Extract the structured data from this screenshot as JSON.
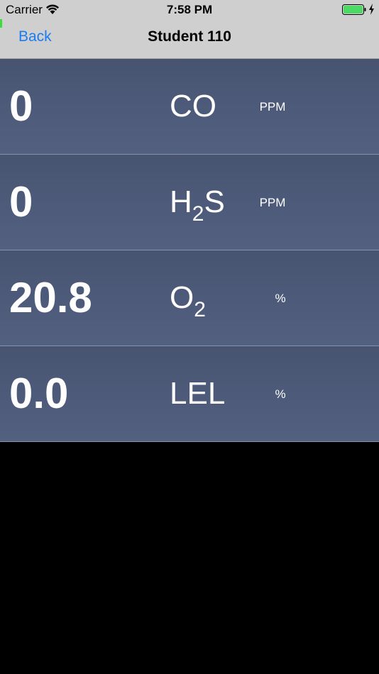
{
  "status_bar": {
    "carrier": "Carrier",
    "time": "7:58 PM"
  },
  "nav": {
    "back_label": "Back",
    "title": "Student 110"
  },
  "readings": [
    {
      "value": "0",
      "gas": "CO",
      "gas_sub": "",
      "gas_suffix": "",
      "unit": "PPM"
    },
    {
      "value": "0",
      "gas": "H",
      "gas_sub": "2",
      "gas_suffix": "S",
      "unit": "PPM"
    },
    {
      "value": "20.8",
      "gas": "O",
      "gas_sub": "2",
      "gas_suffix": "",
      "unit": "%"
    },
    {
      "value": "0.0",
      "gas": "LEL",
      "gas_sub": "",
      "gas_suffix": "",
      "unit": "%"
    }
  ],
  "colors": {
    "accent": "#1a7cf0",
    "row_background": "#4e5b7b",
    "battery": "#4cd964"
  },
  "icons": [
    "wifi-icon",
    "battery-icon",
    "charging-icon"
  ]
}
